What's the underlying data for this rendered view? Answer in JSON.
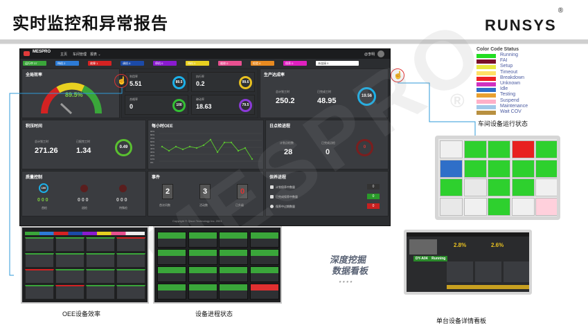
{
  "page": {
    "title": "实时监控和异常报告",
    "brand": "RUNSYS",
    "reg": "®"
  },
  "dashboard": {
    "app_name": "MESPRO",
    "nav": [
      "主页",
      "车间管理",
      "报表 ⌄"
    ],
    "user": "@李明",
    "status_pills": [
      {
        "label": "运行中 37",
        "color": "#3aa63a"
      },
      {
        "label": "待机 2",
        "color": "#2d7bd6"
      },
      {
        "label": "故障 1",
        "color": "#d42222"
      },
      {
        "label": "调机 0",
        "color": "#1b4aa8"
      },
      {
        "label": "停机 0",
        "color": "#8a1ad0"
      },
      {
        "label": "待料 0",
        "color": "#e8d020"
      },
      {
        "label": "维修 0",
        "color": "#e85090"
      },
      {
        "label": "检验 0",
        "color": "#e88a20"
      },
      {
        "label": "保养 0",
        "color": "#e020c0"
      },
      {
        "label": "未连接 0",
        "color": "#ffffff"
      }
    ],
    "oee": {
      "title": "全局效率",
      "value": "89.5%"
    },
    "rates": [
      {
        "label": "利用率",
        "value": "5.51",
        "ring": "89.5",
        "color": "#1cb0e8"
      },
      {
        "label": "执行率",
        "value": "0.2",
        "ring": "99.6",
        "color": "#e8c020"
      },
      {
        "label": "合格率",
        "value": "0",
        "ring": "100",
        "color": "#34c034"
      },
      {
        "label": "稼动率",
        "value": "18.63",
        "ring": "79.5",
        "color": "#8b3ad8"
      }
    ],
    "production": {
      "title": "生产达成率",
      "items": [
        {
          "label": "总计划工时",
          "value": "250.2"
        },
        {
          "label": "已完成工时",
          "value": "48.95"
        }
      ],
      "ring": "19.56"
    },
    "accumulated": {
      "title": "积压时间",
      "items": [
        {
          "label": "总计划工时",
          "value": "271.26"
        },
        {
          "label": "已报完工时",
          "value": "1.34"
        }
      ],
      "ring": "0.49"
    },
    "hourly": {
      "title": "每小时OEE",
      "y_ticks": [
        "90%",
        "80%",
        "70%",
        "60%",
        "50%",
        "40%",
        "30%",
        "20%",
        "10%",
        "0%"
      ]
    },
    "daily": {
      "title": "日点检进程",
      "items": [
        {
          "label": "计划点检数",
          "value": "28"
        },
        {
          "label": "已完成点检",
          "value": "0"
        }
      ],
      "ring": "0"
    },
    "quality": {
      "title": "质量控制",
      "items": [
        {
          "label": "首检",
          "value": "0 0 0"
        },
        {
          "label": "巡检",
          "value": "0 0 0"
        },
        {
          "label": "特殊检",
          "value": "0 0 0"
        }
      ],
      "ring": "100"
    },
    "events": {
      "title": "事件",
      "items": [
        {
          "label": "首次问数",
          "value": "2"
        },
        {
          "label": "活动数",
          "value": "3"
        },
        {
          "label": "已升级",
          "value": "0"
        }
      ]
    },
    "maintenance": {
      "title": "保养进程",
      "items": [
        {
          "label": "计划保养中数量",
          "value": "0"
        },
        {
          "label": "已完成保养中数量",
          "value": "0"
        },
        {
          "label": "保养中过期数量",
          "value": "0"
        }
      ]
    },
    "copyright": "Copyright © Qisun Technology Inc. 2021"
  },
  "legend": {
    "title": "Color Code Status",
    "items": [
      {
        "label": "Running",
        "color": "#22dd22"
      },
      {
        "label": "FAI",
        "color": "#7a0f2a"
      },
      {
        "label": "Setup",
        "color": "#e8e840"
      },
      {
        "label": "Timeout",
        "color": "#ffe066"
      },
      {
        "label": "Breakdown",
        "color": "#ee2222"
      },
      {
        "label": "Unknown",
        "color": "#d030c0"
      },
      {
        "label": "Idle",
        "color": "#2f6fc8"
      },
      {
        "label": "Testing",
        "color": "#e8a030"
      },
      {
        "label": "Suspend",
        "color": "#ffb0c8"
      },
      {
        "label": "Maintenance",
        "color": "#a0c8e8"
      },
      {
        "label": "Wait COV",
        "color": "#b89040"
      }
    ]
  },
  "captions": {
    "workshop": "车间设备运行状态",
    "oee_eff": "OEE设备效率",
    "process": "设备进程状态",
    "single": "单台设备详情看板",
    "mining_line1": "深度挖掘",
    "mining_line2": "数据看板"
  },
  "single_device": {
    "name": "DY-A04",
    "status": "Running",
    "pct1": "2.8%",
    "pct2": "2.6%"
  }
}
